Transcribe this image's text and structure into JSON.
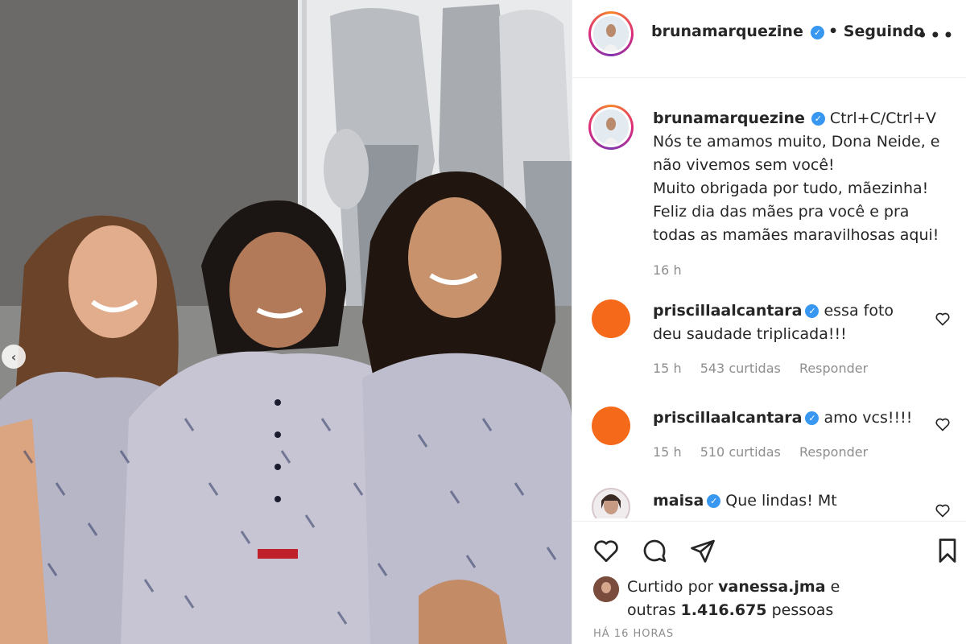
{
  "post": {
    "author": "bruna​marquezine",
    "follow_status": "• Seguindo",
    "more_icon": "more-horizontal-icon"
  },
  "caption": {
    "author": "bruna​marquezine",
    "text_first": "Ctrl+C/Ctrl+V",
    "lines": [
      "Nós te amamos muito, Dona Neide, e",
      "não vivemos sem você!",
      "Muito obrigada por tudo, mãezinha!",
      "Feliz dia das mães pra você e pra",
      "todas as mamães maravilhosas aqui!"
    ],
    "time": "16 h"
  },
  "comments": [
    {
      "author": "priscillaalcantara",
      "text": "essa foto",
      "text2": "deu saudade triplicada!!!",
      "time": "15 h",
      "likes": "543 curtidas",
      "reply": "Responder",
      "avatar_color": "#f56a1a"
    },
    {
      "author": "priscillaalcantara",
      "text": "amo vcs!!!!",
      "text2": "",
      "time": "15 h",
      "likes": "510 curtidas",
      "reply": "Responder",
      "avatar_color": "#f56a1a"
    },
    {
      "author": "maisa",
      "text": "Que lindas! Mt",
      "text2": "",
      "time": "",
      "likes": "",
      "reply": ""
    }
  ],
  "actions": {
    "like_icon": "heart-icon",
    "comment_icon": "comment-icon",
    "share_icon": "send-icon",
    "save_icon": "bookmark-icon"
  },
  "likes": {
    "prefix": "Curtido por",
    "user": "vanessa.jma",
    "suffix": "e",
    "line2_prefix": "outras",
    "count": "1.416.675",
    "line2_suffix": "pessoas"
  },
  "timestamp": "HÁ 16 HORAS",
  "colors": {
    "verified": "#3897f0",
    "meta": "#8e8e8e",
    "text": "#262626"
  }
}
